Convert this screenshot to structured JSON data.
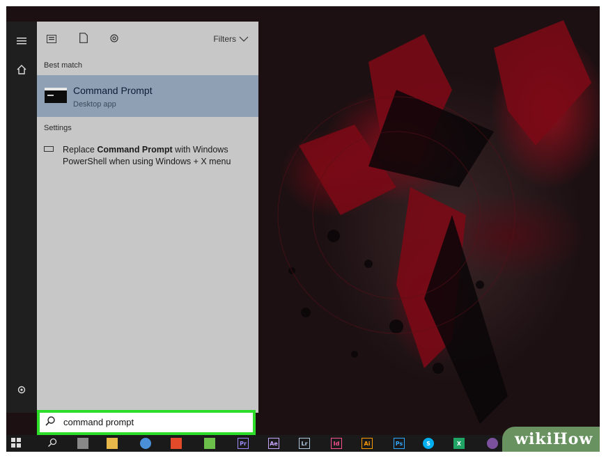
{
  "toolbar": {
    "filters_label": "Filters",
    "icons": [
      "apps-icon",
      "documents-icon",
      "web-settings-icon"
    ]
  },
  "best_match": {
    "section_label": "Best match",
    "title": "Command Prompt",
    "subtitle": "Desktop app"
  },
  "settings": {
    "section_label": "Settings",
    "item": {
      "prefix": "Replace ",
      "bold": "Command Prompt",
      "suffix": " with Windows PowerShell when using Windows + X menu"
    }
  },
  "search": {
    "value": "command prompt"
  },
  "taskbar": {
    "apps": [
      {
        "name": "start-icon",
        "label": ""
      },
      {
        "name": "search-icon",
        "label": ""
      },
      {
        "name": "calculator-icon",
        "label": ""
      },
      {
        "name": "file-explorer-icon",
        "label": ""
      },
      {
        "name": "chrome-icon",
        "label": ""
      },
      {
        "name": "store-icon",
        "label": ""
      },
      {
        "name": "notepad-icon",
        "label": ""
      },
      {
        "name": "premiere-icon",
        "label": "Pr",
        "color": "#9b8cff"
      },
      {
        "name": "after-effects-icon",
        "label": "Ae",
        "color": "#c9a6ff"
      },
      {
        "name": "lightroom-icon",
        "label": "Lr",
        "color": "#b0c8e0"
      },
      {
        "name": "indesign-icon",
        "label": "Id",
        "color": "#ff4f8f"
      },
      {
        "name": "illustrator-icon",
        "label": "Ai",
        "color": "#ff9a00"
      },
      {
        "name": "photoshop-icon",
        "label": "Ps",
        "color": "#31a8ff"
      },
      {
        "name": "skype-icon",
        "label": "S",
        "color": "#00aff0"
      },
      {
        "name": "excel-icon",
        "label": "X",
        "color": "#21a366"
      },
      {
        "name": "viber-icon",
        "label": "",
        "color": "#7b519d"
      }
    ],
    "watermark": "wikiHow"
  },
  "colors": {
    "highlight_box": "#2ddd2a",
    "best_match_bg": "#8fa0b4",
    "panel_bg": "#c7c7c7"
  }
}
